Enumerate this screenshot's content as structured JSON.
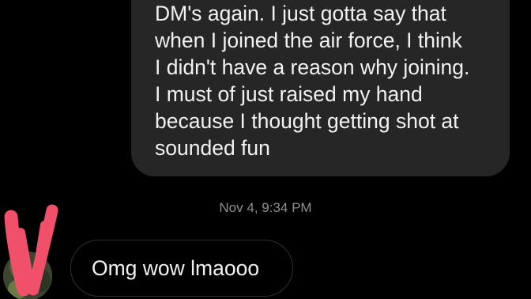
{
  "thread": {
    "outgoing_message": {
      "lines": [
        "DM's again. I just gotta say that",
        "when I joined the air force, I think",
        "I didn't have a reason why joining.",
        "I must of just raised my hand",
        "because I thought getting shot at",
        "sounded fun"
      ]
    },
    "timestamp": "Nov 4, 9:34 PM",
    "incoming_message": {
      "text": "Omg wow lmaooo"
    }
  },
  "colors": {
    "background": "#000000",
    "outgoing_bubble": "#262626",
    "message_text": "#f2f2f2",
    "timestamp_text": "#8e8e8e",
    "incoming_border": "#2f2f2f",
    "redaction_mark": "#f0506a"
  },
  "icons": {
    "avatar": "profile-avatar",
    "redaction": "red-scribble-redaction"
  }
}
